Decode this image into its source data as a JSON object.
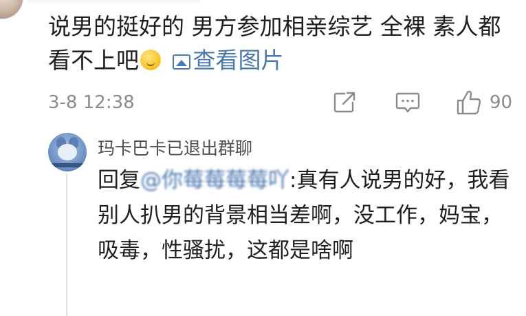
{
  "comment": {
    "text": "说男的挺好的 男方参加相亲综艺 全裸 素人都看不上吧",
    "emoji": "sweat-smile-emoji",
    "view_image_label": "查看图片",
    "timestamp": "3-8 12:38",
    "like_count": "90"
  },
  "reply": {
    "username": "玛卡巴卡已退出群聊",
    "prefix": "回复",
    "mention": "@你莓莓莓莓吖",
    "separator": ":",
    "text": "真有人说男的好，我看别人扒男的背景相当差啊，没工作，妈宝，吸毒，性骚扰，这都是啥啊"
  },
  "colors": {
    "link": "#4a78b0",
    "meta": "#8a8a8a",
    "text": "#1f1f1f"
  }
}
